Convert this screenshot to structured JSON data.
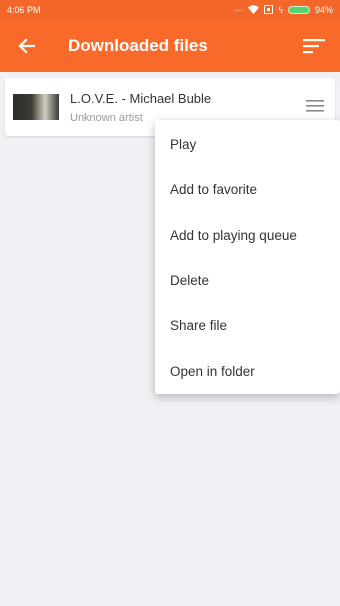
{
  "status_bar": {
    "time": "4:06 PM",
    "battery": "94%"
  },
  "app_bar": {
    "title": "Downloaded files",
    "back_icon": "arrow-back-icon",
    "sort_icon": "sort-icon",
    "background": "#f8692a"
  },
  "files": [
    {
      "title": "L.O.V.E. - Michael Buble",
      "artist": "Unknown artist"
    }
  ],
  "context_menu": {
    "items": [
      "Play",
      "Add to favorite",
      "Add to playing queue",
      "Delete",
      "Share file",
      "Open in folder"
    ]
  }
}
